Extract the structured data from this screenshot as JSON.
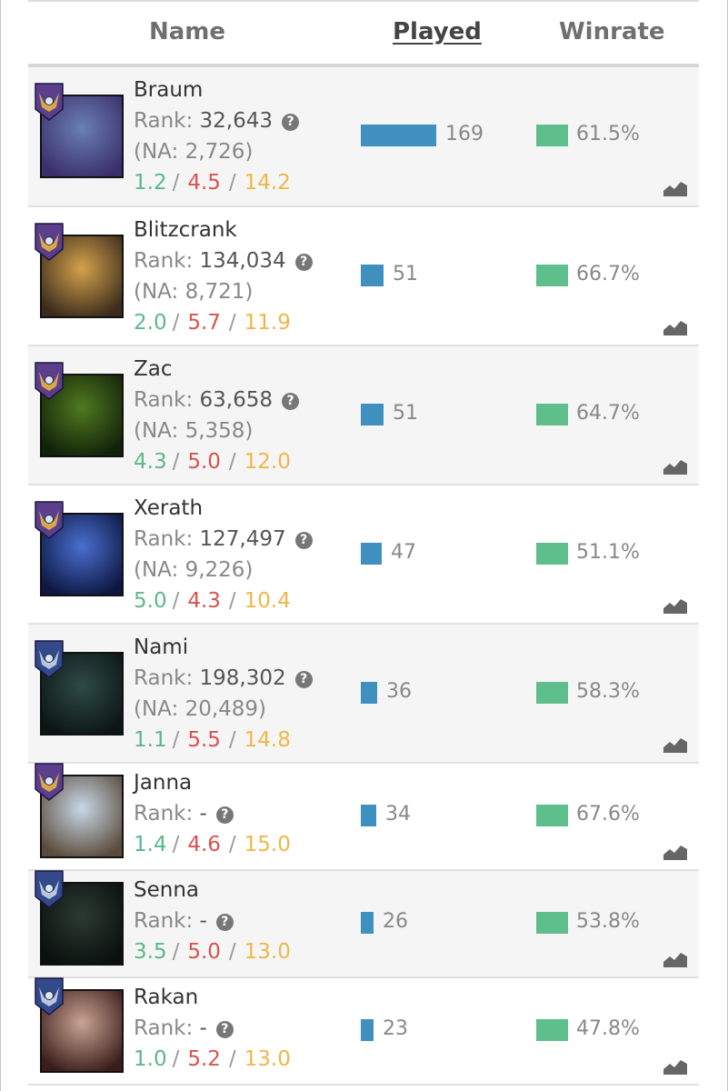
{
  "header": {
    "name": "Name",
    "played": "Played",
    "winrate": "Winrate"
  },
  "rank_label": "Rank:",
  "colors": {
    "played_bar": "#3f8fbf",
    "win_bar": "#5fbf8c",
    "kills": "#5cb88a",
    "deaths": "#d9534f",
    "assists": "#efb748"
  },
  "rows": [
    {
      "name": "Braum",
      "rank": "32,643",
      "na": "(NA: 2,726)",
      "k": "1.2",
      "d": "4.5",
      "a": "14.2",
      "played": "169",
      "played_value": 169,
      "winrate": "61.5%",
      "badge": "purple-emblem-icon"
    },
    {
      "name": "Blitzcrank",
      "rank": "134,034",
      "na": "(NA: 8,721)",
      "k": "2.0",
      "d": "5.7",
      "a": "11.9",
      "played": "51",
      "played_value": 51,
      "winrate": "66.7%",
      "badge": "purple-emblem-icon"
    },
    {
      "name": "Zac",
      "rank": "63,658",
      "na": "(NA: 5,358)",
      "k": "4.3",
      "d": "5.0",
      "a": "12.0",
      "played": "51",
      "played_value": 51,
      "winrate": "64.7%",
      "badge": "purple-emblem-icon"
    },
    {
      "name": "Xerath",
      "rank": "127,497",
      "na": "(NA: 9,226)",
      "k": "5.0",
      "d": "4.3",
      "a": "10.4",
      "played": "47",
      "played_value": 47,
      "winrate": "51.1%",
      "badge": "purple-emblem-icon"
    },
    {
      "name": "Nami",
      "rank": "198,302",
      "na": "(NA: 20,489)",
      "k": "1.1",
      "d": "5.5",
      "a": "14.8",
      "played": "36",
      "played_value": 36,
      "winrate": "58.3%",
      "badge": "blue-emblem-icon"
    },
    {
      "name": "Janna",
      "rank": "-",
      "na": "",
      "k": "1.4",
      "d": "4.6",
      "a": "15.0",
      "played": "34",
      "played_value": 34,
      "winrate": "67.6%",
      "badge": "purple-emblem-icon"
    },
    {
      "name": "Senna",
      "rank": "-",
      "na": "",
      "k": "3.5",
      "d": "5.0",
      "a": "13.0",
      "played": "26",
      "played_value": 26,
      "winrate": "53.8%",
      "badge": "blue-emblem-icon"
    },
    {
      "name": "Rakan",
      "rank": "-",
      "na": "",
      "k": "1.0",
      "d": "5.2",
      "a": "13.0",
      "played": "23",
      "played_value": 23,
      "winrate": "47.8%",
      "badge": "blue-emblem-icon"
    }
  ]
}
